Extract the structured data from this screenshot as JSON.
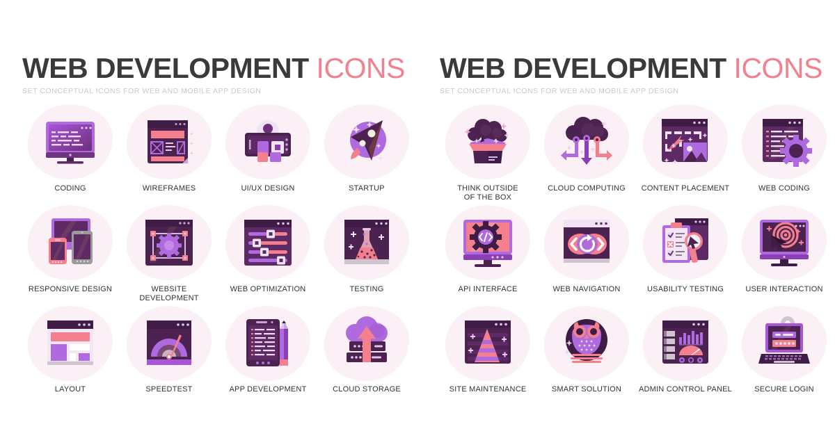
{
  "groups": [
    {
      "title_main": "WEB DEVELOPMENT",
      "title_accent": "ICONS",
      "subtitle": "SET CONCEPTUAL ICONS FOR WEB AND MOBILE APP DESIGN",
      "rows": [
        [
          {
            "label": "CODING",
            "icon": "monitor-code-icon"
          },
          {
            "label": "WIREFRAMES",
            "icon": "wireframe-browser-icon"
          },
          {
            "label": "UI/UX DESIGN",
            "icon": "tablet-avatar-blocks-icon"
          },
          {
            "label": "STARTUP",
            "icon": "rocket-icon"
          }
        ],
        [
          {
            "label": "RESPONSIVE DESIGN",
            "icon": "devices-icon"
          },
          {
            "label": "WEBSITE\nDEVELOPMENT",
            "icon": "browser-gear-icon"
          },
          {
            "label": "WEB OPTIMIZATION",
            "icon": "sliders-icon"
          },
          {
            "label": "TESTING",
            "icon": "flask-icon"
          }
        ],
        [
          {
            "label": "LAYOUT",
            "icon": "layout-blocks-icon"
          },
          {
            "label": "SPEEDTEST",
            "icon": "gauge-icon"
          },
          {
            "label": "APP DEVELOPMENT",
            "icon": "tablet-pencil-icon"
          },
          {
            "label": "CLOUD STORAGE",
            "icon": "cloud-servers-arrow-icon"
          }
        ]
      ]
    },
    {
      "title_main": "WEB DEVELOPMENT",
      "title_accent": "ICONS",
      "subtitle": "SET CONCEPTUAL ICONS FOR WEB AND MOBILE APP DESIGN",
      "rows": [
        [
          {
            "label": "THINK OUTSIDE\nOF THE BOX",
            "icon": "box-cloud-burst-icon"
          },
          {
            "label": "CLOUD COMPUTING",
            "icon": "cloud-arrows-icon"
          },
          {
            "label": "CONTENT PLACEMENT",
            "icon": "browser-image-cursor-icon"
          },
          {
            "label": "WEB CODING",
            "icon": "code-gear-icon"
          }
        ],
        [
          {
            "label": "API INTERFACE",
            "icon": "monitor-gear-brackets-icon"
          },
          {
            "label": "WEB NAVIGATION",
            "icon": "refresh-arrows-icon"
          },
          {
            "label": "USABILITY TESTING",
            "icon": "clipboard-magnifier-icon"
          },
          {
            "label": "USER INTERACTION",
            "icon": "monitor-target-cursor-icon"
          }
        ],
        [
          {
            "label": "SITE MAINTENANCE",
            "icon": "traffic-cone-icon"
          },
          {
            "label": "SMART SOLUTION",
            "icon": "owl-icon"
          },
          {
            "label": "ADMIN CONTROL PANEL",
            "icon": "dashboard-charts-icon"
          },
          {
            "label": "SECURE LOGIN",
            "icon": "laptop-lock-icon"
          }
        ]
      ]
    }
  ],
  "colors": {
    "title": "#3a3a3a",
    "accent": "#f2818f",
    "subtitle": "#c9c9c9",
    "label": "#333333",
    "blob": "#faf0f6",
    "purple_light": "#b06ae0",
    "purple": "#8b3fb5",
    "purple_dark": "#4b2250",
    "pink": "#f4808e",
    "pink_light": "#f9a0a8",
    "background": "#ffffff"
  }
}
